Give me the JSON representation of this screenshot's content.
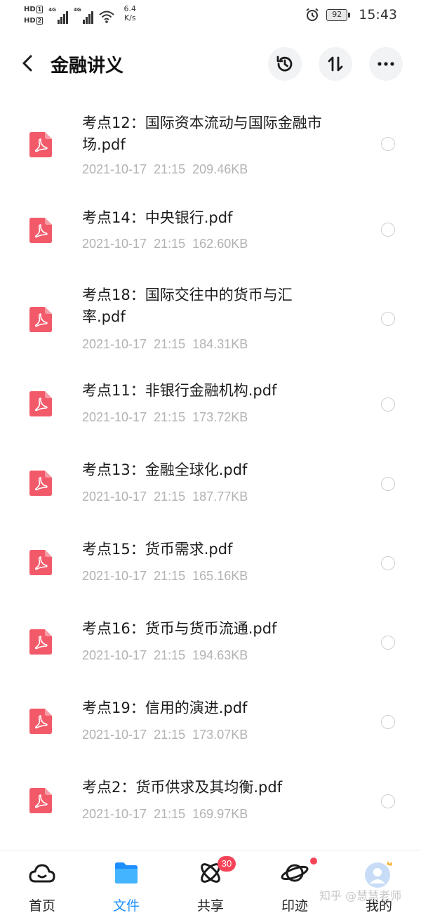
{
  "status_bar": {
    "sim1": "HD",
    "sim1_num": "1",
    "sim2": "HD",
    "sim2_num": "2",
    "network1": "4G",
    "network2": "4G",
    "speed_value": "6.4",
    "speed_unit": "K/s",
    "battery": "92",
    "time": "15:43",
    "icons": [
      "signal-icon",
      "wifi-icon",
      "alarm-icon",
      "battery-icon"
    ]
  },
  "header": {
    "title": "金融讲义",
    "icons": [
      "back-icon",
      "history-icon",
      "sort-icon",
      "more-icon"
    ]
  },
  "files": [
    {
      "name": "考点12：国际资本流动与国际金融市场.pdf",
      "date": "2021-10-17",
      "time": "21:15",
      "size": "209.46KB"
    },
    {
      "name": "考点14：中央银行.pdf",
      "date": "2021-10-17",
      "time": "21:15",
      "size": "162.60KB"
    },
    {
      "name": "考点18：国际交往中的货币与汇率.pdf",
      "date": "2021-10-17",
      "time": "21:15",
      "size": "184.31KB"
    },
    {
      "name": "考点11：非银行金融机构.pdf",
      "date": "2021-10-17",
      "time": "21:15",
      "size": "173.72KB"
    },
    {
      "name": "考点13：金融全球化.pdf",
      "date": "2021-10-17",
      "time": "21:15",
      "size": "187.77KB"
    },
    {
      "name": "考点15：货币需求.pdf",
      "date": "2021-10-17",
      "time": "21:15",
      "size": "165.16KB"
    },
    {
      "name": "考点16：货币与货币流通.pdf",
      "date": "2021-10-17",
      "time": "21:15",
      "size": "194.63KB"
    },
    {
      "name": "考点19：信用的演进.pdf",
      "date": "2021-10-17",
      "time": "21:15",
      "size": "173.07KB"
    },
    {
      "name": "考点2：货币供求及其均衡.pdf",
      "date": "2021-10-17",
      "time": "21:15",
      "size": "169.97KB"
    }
  ],
  "bottom_nav": [
    {
      "label": "首页",
      "icon": "home-cloud-icon",
      "active": false
    },
    {
      "label": "文件",
      "icon": "folder-icon",
      "active": true
    },
    {
      "label": "共享",
      "icon": "share-atom-icon",
      "active": false,
      "badge": "30"
    },
    {
      "label": "印迹",
      "icon": "planet-icon",
      "active": false,
      "dot": true
    },
    {
      "label": "我的",
      "icon": "avatar-icon",
      "active": false
    }
  ],
  "watermark": "知乎 @慧慧老师",
  "colors": {
    "accent": "#1e8ffc",
    "pdf_red": "#f25a6a",
    "badge_red": "#f54458",
    "meta_gray": "#b2b2b2"
  }
}
